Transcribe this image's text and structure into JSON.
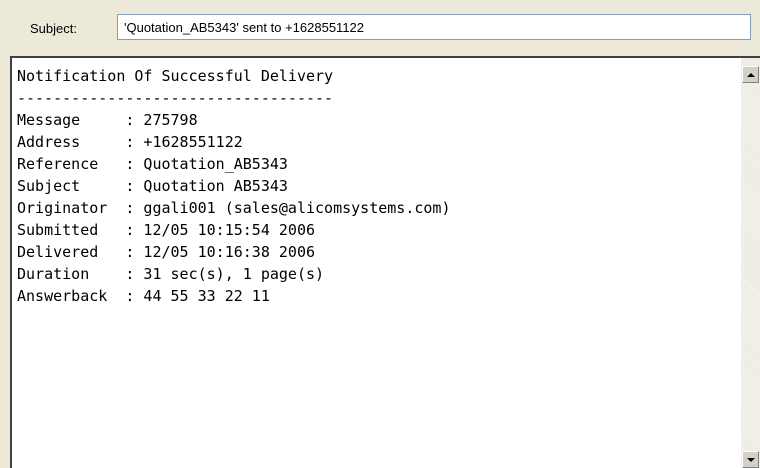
{
  "subject": {
    "label": "Subject:",
    "value": "'Quotation_AB5343' sent to +1628551122"
  },
  "body": {
    "lines": [
      "Notification Of Successful Delivery",
      "-----------------------------------",
      "Message     : 275798",
      "Address     : +1628551122",
      "Reference   : Quotation_AB5343",
      "Subject     : Quotation AB5343",
      "Originator  : ggali001 (sales@alicomsystems.com)",
      "Submitted   : 12/05 10:15:54 2006",
      "Delivered   : 12/05 10:16:38 2006",
      "Duration    : 31 sec(s), 1 page(s)",
      "Answerback  : 44 55 33 22 11"
    ]
  },
  "scrollbar": {
    "up_icon": "arrow-up",
    "down_icon": "arrow-down"
  }
}
